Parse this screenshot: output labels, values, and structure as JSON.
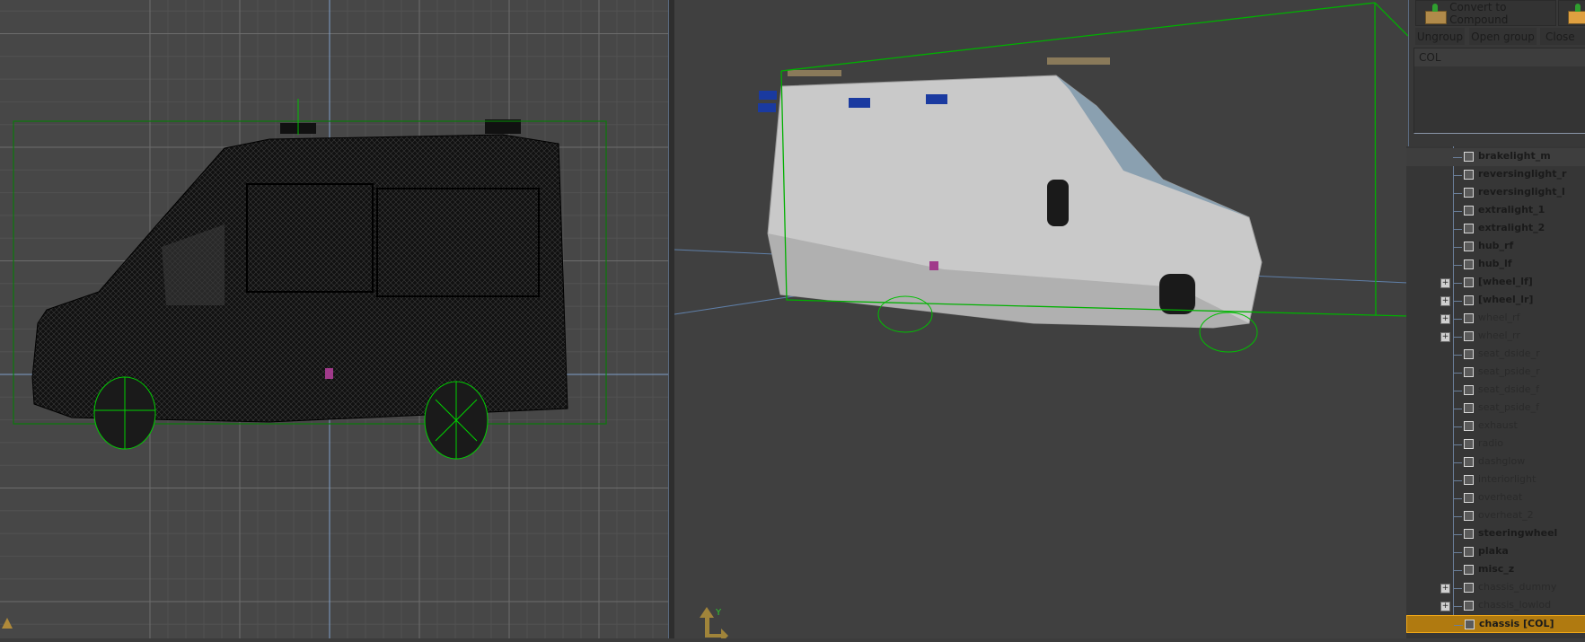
{
  "toolbar": {
    "convert_label": "Convert to Compound",
    "ungroup_label": "Ungroup",
    "open_group_label": "Open group",
    "close_group_label": "Close"
  },
  "col_panel": {
    "header": "COL"
  },
  "tree": {
    "items": [
      {
        "label": "brakelight_m",
        "bold": true,
        "expand": false
      },
      {
        "label": "reversinglight_r",
        "bold": true,
        "expand": false
      },
      {
        "label": "reversinglight_l",
        "bold": true,
        "expand": false
      },
      {
        "label": "extralight_1",
        "bold": true,
        "expand": false
      },
      {
        "label": "extralight_2",
        "bold": true,
        "expand": false
      },
      {
        "label": "hub_rf",
        "bold": true,
        "expand": false
      },
      {
        "label": "hub_lf",
        "bold": true,
        "expand": false
      },
      {
        "label": "[wheel_lf]",
        "bold": true,
        "expand": true
      },
      {
        "label": "[wheel_lr]",
        "bold": true,
        "expand": true
      },
      {
        "label": "wheel_rf",
        "bold": false,
        "expand": true
      },
      {
        "label": "wheel_rr",
        "bold": false,
        "expand": true
      },
      {
        "label": "seat_dside_r",
        "bold": false,
        "expand": false
      },
      {
        "label": "seat_pside_r",
        "bold": false,
        "expand": false
      },
      {
        "label": "seat_dside_f",
        "bold": false,
        "expand": false
      },
      {
        "label": "seat_pside_f",
        "bold": false,
        "expand": false
      },
      {
        "label": "exhaust",
        "bold": false,
        "expand": false
      },
      {
        "label": "radio",
        "bold": false,
        "expand": false
      },
      {
        "label": "dashglow",
        "bold": false,
        "expand": false
      },
      {
        "label": "interiorlight",
        "bold": false,
        "expand": false
      },
      {
        "label": "overheat",
        "bold": false,
        "expand": false
      },
      {
        "label": "overheat_2",
        "bold": false,
        "expand": false
      },
      {
        "label": "steeringwheel",
        "bold": true,
        "expand": false
      },
      {
        "label": "plaka",
        "bold": true,
        "expand": false
      },
      {
        "label": "misc_z",
        "bold": true,
        "expand": false
      },
      {
        "label": "chassis_dummy",
        "bold": false,
        "expand": true
      },
      {
        "label": "chassis_lowlod",
        "bold": false,
        "expand": true
      },
      {
        "label": "chassis [COL]",
        "bold": true,
        "expand": false,
        "selected": true
      }
    ],
    "expand_glyph": "+"
  },
  "viewports": {
    "axis_label": "Y",
    "colors": {
      "bbox": "#00b000",
      "axis": "#6a8ab0",
      "selection": "#b07a10"
    }
  }
}
